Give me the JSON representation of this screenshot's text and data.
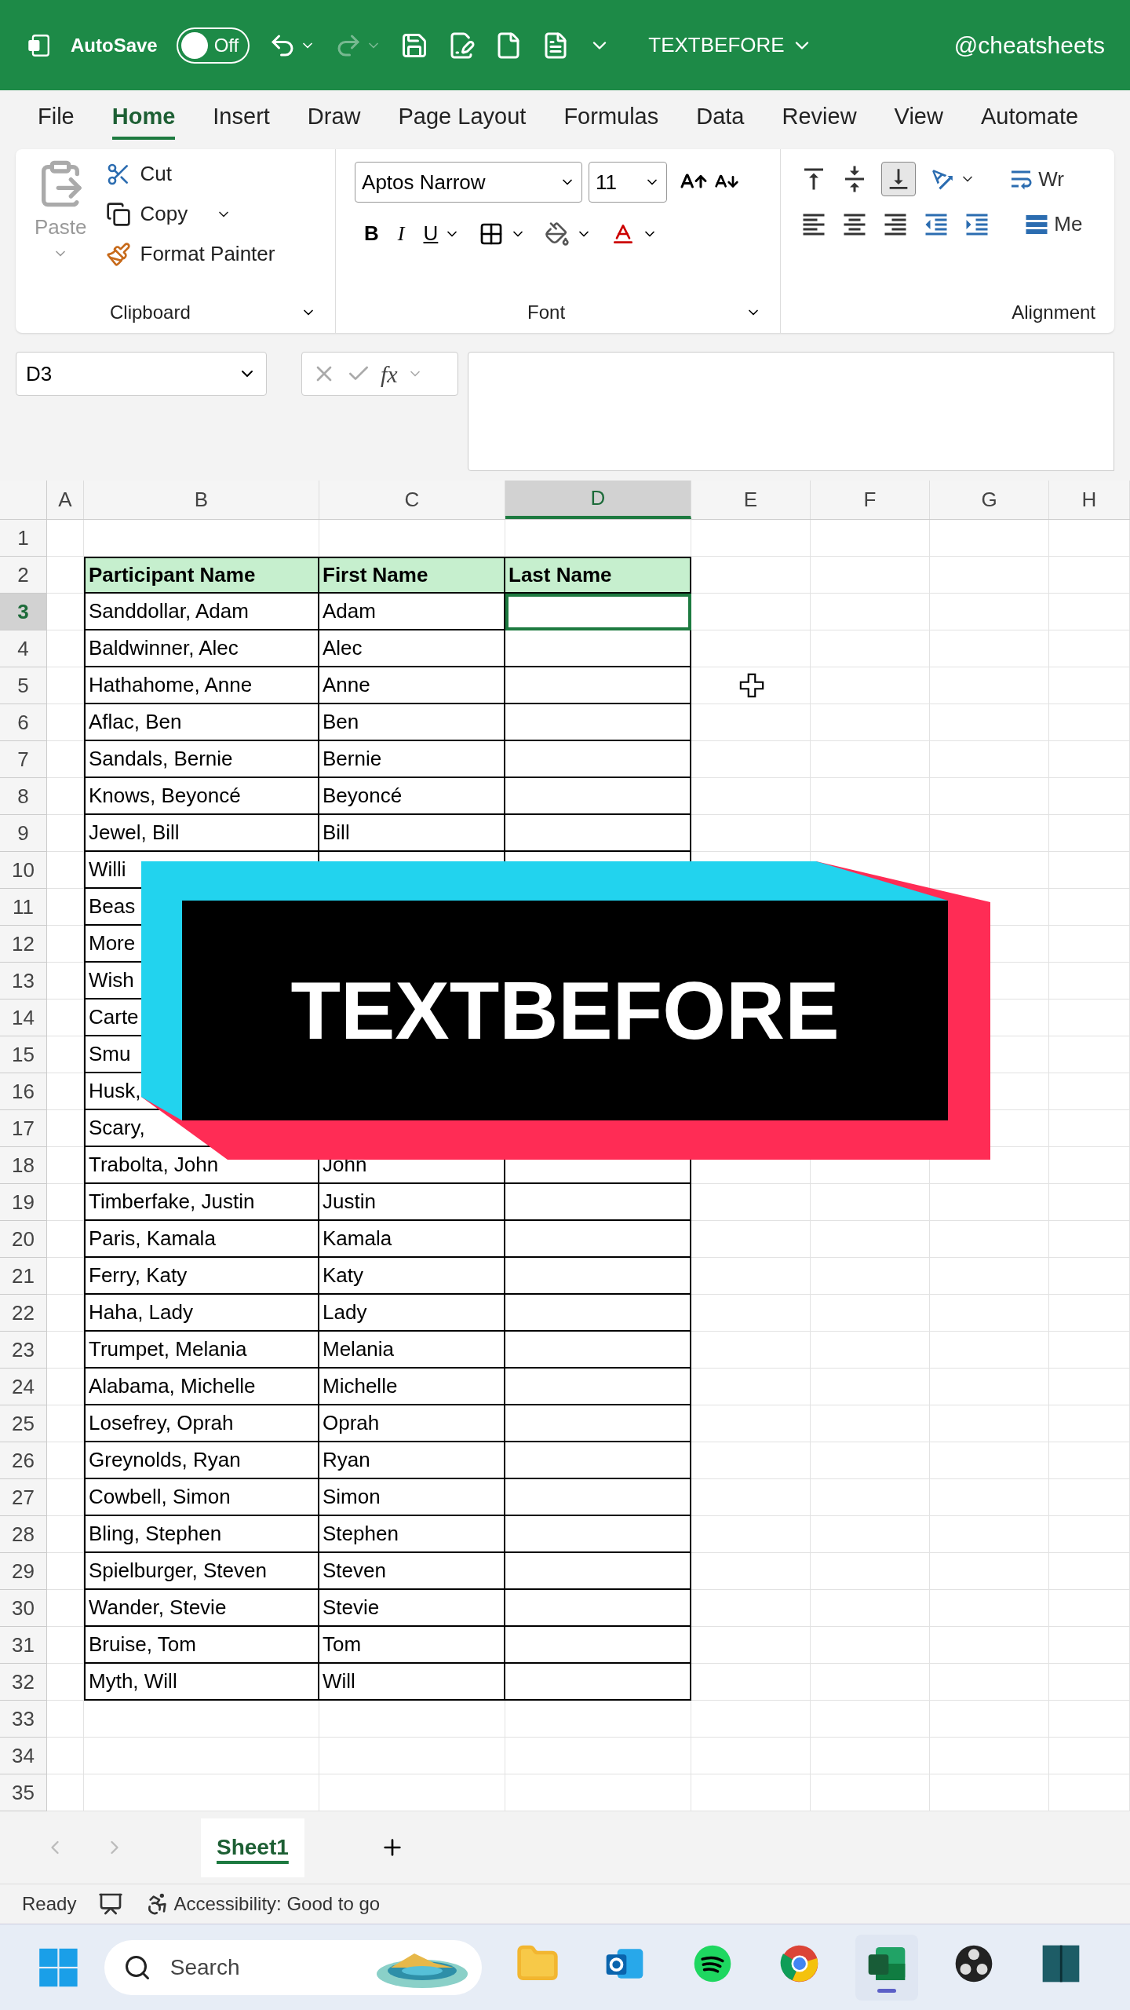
{
  "title_bar": {
    "autosave_label": "AutoSave",
    "autosave": {
      "on": false,
      "label": "Off"
    },
    "file_name": "TEXTBEFORE",
    "user": "@cheatsheets"
  },
  "menu_tabs": [
    {
      "label": "File",
      "selected": false
    },
    {
      "label": "Home",
      "selected": true
    },
    {
      "label": "Insert",
      "selected": false
    },
    {
      "label": "Draw",
      "selected": false
    },
    {
      "label": "Page Layout",
      "selected": false
    },
    {
      "label": "Formulas",
      "selected": false
    },
    {
      "label": "Data",
      "selected": false
    },
    {
      "label": "Review",
      "selected": false
    },
    {
      "label": "View",
      "selected": false
    },
    {
      "label": "Automate",
      "selected": false
    }
  ],
  "ribbon": {
    "clipboard": {
      "paste": "Paste",
      "cut": "Cut",
      "copy": "Copy",
      "format_painter": "Format Painter",
      "title": "Clipboard"
    },
    "font": {
      "family": "Aptos Narrow",
      "size": "11",
      "bold": "B",
      "italic": "I",
      "underline": "U",
      "title": "Font"
    },
    "alignment": {
      "title": "Alignment",
      "wrap": "Wr",
      "merge": "Me"
    }
  },
  "formula_bar": {
    "name_box": "D3",
    "fx": "fx"
  },
  "columns": [
    {
      "label": "A",
      "selected": false
    },
    {
      "label": "B",
      "selected": false
    },
    {
      "label": "C",
      "selected": false
    },
    {
      "label": "D",
      "selected": true
    },
    {
      "label": "E",
      "selected": false
    },
    {
      "label": "F",
      "selected": false
    },
    {
      "label": "G",
      "selected": false
    },
    {
      "label": "H",
      "selected": false
    }
  ],
  "rows": [
    {
      "label": "1",
      "selected": false,
      "kind": "blank"
    },
    {
      "label": "2",
      "selected": false,
      "kind": "header",
      "b": "Participant Name",
      "c": "First Name",
      "d": "Last Name"
    },
    {
      "label": "3",
      "selected": true,
      "kind": "data",
      "b": "Sanddollar, Adam",
      "c": "Adam"
    },
    {
      "label": "4",
      "selected": false,
      "kind": "data",
      "b": "Baldwinner, Alec",
      "c": "Alec"
    },
    {
      "label": "5",
      "selected": false,
      "kind": "data",
      "b": "Hathahome, Anne",
      "c": "Anne",
      "cursor": true
    },
    {
      "label": "6",
      "selected": false,
      "kind": "data",
      "b": "Aflac, Ben",
      "c": "Ben"
    },
    {
      "label": "7",
      "selected": false,
      "kind": "data",
      "b": "Sandals, Bernie",
      "c": "Bernie"
    },
    {
      "label": "8",
      "selected": false,
      "kind": "data",
      "b": "Knows, Beyoncé",
      "c": "Beyoncé"
    },
    {
      "label": "9",
      "selected": false,
      "kind": "data",
      "b": "Jewel, Bill",
      "c": "Bill"
    },
    {
      "label": "10",
      "selected": false,
      "kind": "data",
      "b": "Willi"
    },
    {
      "label": "11",
      "selected": false,
      "kind": "data",
      "b": "Beas"
    },
    {
      "label": "12",
      "selected": false,
      "kind": "data",
      "b": "More"
    },
    {
      "label": "13",
      "selected": false,
      "kind": "data",
      "b": "Wish"
    },
    {
      "label": "14",
      "selected": false,
      "kind": "data",
      "b": "Carte"
    },
    {
      "label": "15",
      "selected": false,
      "kind": "data",
      "b": "Smu"
    },
    {
      "label": "16",
      "selected": false,
      "kind": "data",
      "b": "Husk,"
    },
    {
      "label": "17",
      "selected": false,
      "kind": "data",
      "b": "Scary,"
    },
    {
      "label": "18",
      "selected": false,
      "kind": "data",
      "b": "Trabolta, John",
      "c": "John"
    },
    {
      "label": "19",
      "selected": false,
      "kind": "data",
      "b": "Timberfake, Justin",
      "c": "Justin"
    },
    {
      "label": "20",
      "selected": false,
      "kind": "data",
      "b": "Paris, Kamala",
      "c": "Kamala"
    },
    {
      "label": "21",
      "selected": false,
      "kind": "data",
      "b": "Ferry, Katy",
      "c": "Katy"
    },
    {
      "label": "22",
      "selected": false,
      "kind": "data",
      "b": "Haha, Lady",
      "c": "Lady"
    },
    {
      "label": "23",
      "selected": false,
      "kind": "data",
      "b": "Trumpet, Melania",
      "c": "Melania"
    },
    {
      "label": "24",
      "selected": false,
      "kind": "data",
      "b": "Alabama, Michelle",
      "c": "Michelle"
    },
    {
      "label": "25",
      "selected": false,
      "kind": "data",
      "b": "Losefrey, Oprah",
      "c": "Oprah"
    },
    {
      "label": "26",
      "selected": false,
      "kind": "data",
      "b": "Greynolds, Ryan",
      "c": "Ryan"
    },
    {
      "label": "27",
      "selected": false,
      "kind": "data",
      "b": "Cowbell, Simon",
      "c": "Simon"
    },
    {
      "label": "28",
      "selected": false,
      "kind": "data",
      "b": "Bling, Stephen",
      "c": "Stephen"
    },
    {
      "label": "29",
      "selected": false,
      "kind": "data",
      "b": "Spielburger, Steven",
      "c": "Steven"
    },
    {
      "label": "30",
      "selected": false,
      "kind": "data",
      "b": "Wander, Stevie",
      "c": "Stevie"
    },
    {
      "label": "31",
      "selected": false,
      "kind": "data",
      "b": "Bruise, Tom",
      "c": "Tom"
    },
    {
      "label": "32",
      "selected": false,
      "kind": "data",
      "b": "Myth, Will",
      "c": "Will"
    },
    {
      "label": "33",
      "selected": false,
      "kind": "blank"
    },
    {
      "label": "34",
      "selected": false,
      "kind": "blank"
    },
    {
      "label": "35",
      "selected": false,
      "kind": "blank"
    }
  ],
  "banner": {
    "text": "TEXTBEFORE"
  },
  "sheet_tabs": [
    {
      "label": "Sheet1",
      "selected": true
    }
  ],
  "status_bar": {
    "mode": "Ready",
    "accessibility": "Accessibility: Good to go"
  },
  "taskbar": {
    "search": {
      "placeholder": "Search"
    },
    "apps": [
      {
        "kind": "folder",
        "selected": false
      },
      {
        "kind": "mail",
        "selected": false
      },
      {
        "kind": "music",
        "selected": false
      },
      {
        "kind": "browser",
        "selected": false
      },
      {
        "kind": "sheet",
        "selected": true
      },
      {
        "kind": "recorder",
        "selected": false
      },
      {
        "kind": "book",
        "selected": false
      }
    ]
  }
}
